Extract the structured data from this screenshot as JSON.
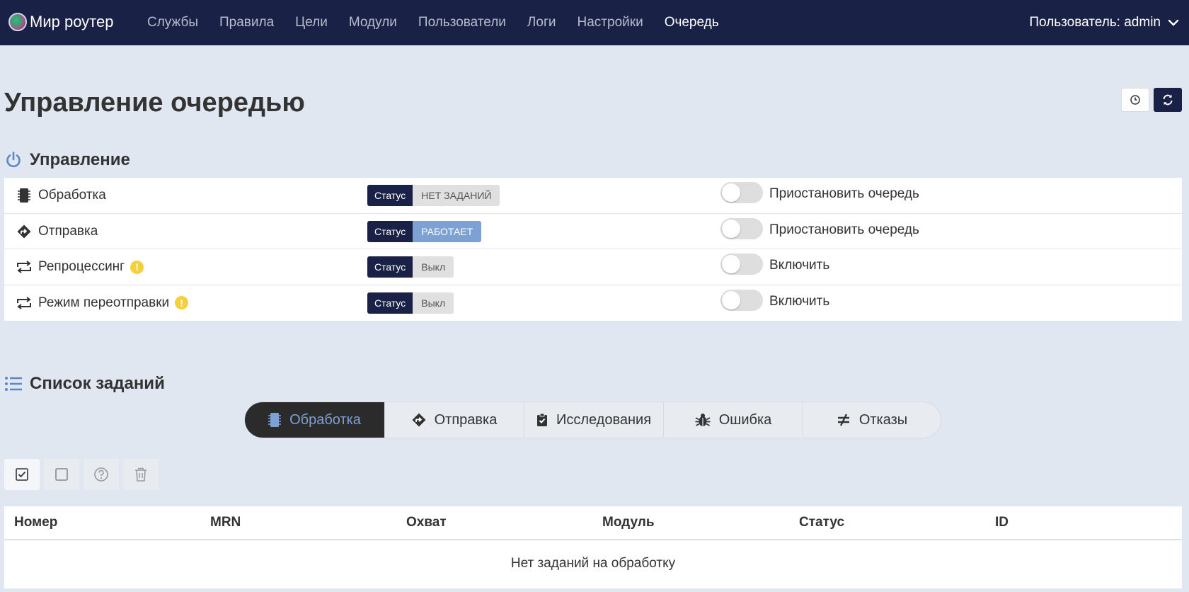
{
  "navbar": {
    "brand": "Мир роутер",
    "items": [
      {
        "label": "Службы"
      },
      {
        "label": "Правила"
      },
      {
        "label": "Цели"
      },
      {
        "label": "Модули"
      },
      {
        "label": "Пользователи"
      },
      {
        "label": "Логи"
      },
      {
        "label": "Настройки"
      },
      {
        "label": "Очередь",
        "active": true
      }
    ],
    "user": "Пользователь: admin"
  },
  "page": {
    "title": "Управление очередью"
  },
  "control": {
    "title": "Управление",
    "status_label": "Статус",
    "rows": [
      {
        "label": "Обработка",
        "icon": "processor-icon",
        "status": "НЕТ ЗАДАНИЙ",
        "toggle_label": "Приостановить очередь",
        "warning": false,
        "enabled": false
      },
      {
        "label": "Отправка",
        "icon": "route-diamond-icon",
        "status": "РАБОТАЕТ",
        "toggle_label": "Приостановить очередь",
        "warning": false,
        "enabled": false
      },
      {
        "label": "Репроцессинг",
        "icon": "repeat-icon",
        "status": "Выкл",
        "toggle_label": "Включить",
        "warning": true,
        "enabled": false
      },
      {
        "label": "Режим переотправки",
        "icon": "repeat-icon",
        "status": "Выкл",
        "toggle_label": "Включить",
        "warning": true,
        "enabled": false
      }
    ]
  },
  "tasks": {
    "title": "Список заданий",
    "tabs": [
      {
        "label": "Обработка",
        "icon": "processor-icon",
        "active": true
      },
      {
        "label": "Отправка",
        "icon": "route-diamond-icon"
      },
      {
        "label": "Исследования",
        "icon": "clipboard-check-icon"
      },
      {
        "label": "Ошибка",
        "icon": "bug-icon"
      },
      {
        "label": "Отказы",
        "icon": "not-equal-icon"
      }
    ],
    "toolbar": [
      "check-all-icon",
      "uncheck-icon",
      "help-icon",
      "trash-icon"
    ],
    "columns": [
      "Номер",
      "MRN",
      "Охват",
      "Модуль",
      "Статус",
      "ID"
    ],
    "empty_text": "Нет заданий на обработку"
  },
  "colors": {
    "navbar": "#1a2147",
    "background": "#e0e7f0",
    "accent": "#7ea1d4",
    "warning": "#f4d03f"
  }
}
